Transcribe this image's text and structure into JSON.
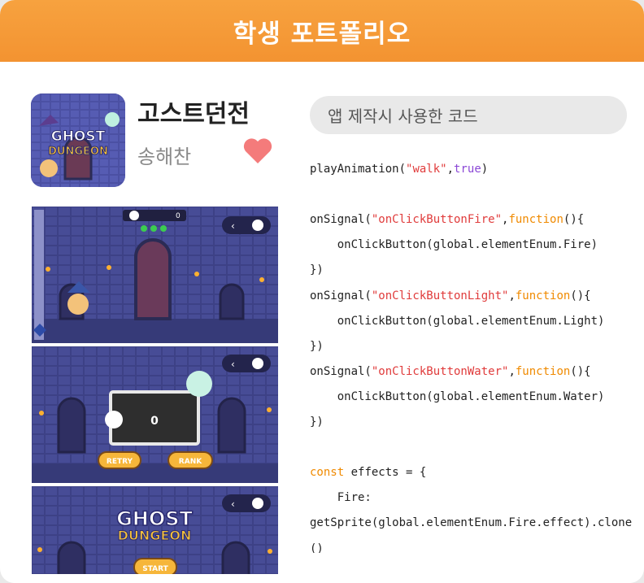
{
  "header": {
    "title": "학생 포트폴리오"
  },
  "app": {
    "title": "고스트던전",
    "author": "송해찬",
    "icon_text_1": "GHOST",
    "icon_text_2": "DUNGEON"
  },
  "shots": [
    {
      "counter": "0"
    },
    {
      "score": "0",
      "retry": "RETRY",
      "rank": "RANK"
    },
    {
      "logo_1": "GHOST",
      "logo_2": "DUNGEON",
      "start": "START"
    }
  ],
  "code": {
    "title": "앱 제작시 사용한 코드",
    "lines": [
      [
        {
          "t": "playAnimation(",
          "c": ""
        },
        {
          "t": "\"walk\"",
          "c": "str"
        },
        {
          "t": ",",
          "c": ""
        },
        {
          "t": "true",
          "c": "kw"
        },
        {
          "t": ")",
          "c": ""
        }
      ],
      [],
      [
        {
          "t": "onSignal(",
          "c": ""
        },
        {
          "t": "\"onClickButtonFire\"",
          "c": "str"
        },
        {
          "t": ",",
          "c": ""
        },
        {
          "t": "function",
          "c": "fn"
        },
        {
          "t": "(){",
          "c": ""
        }
      ],
      [
        {
          "t": "    onClickButton(global.elementEnum.Fire)",
          "c": ""
        }
      ],
      [
        {
          "t": "})",
          "c": ""
        }
      ],
      [
        {
          "t": "onSignal(",
          "c": ""
        },
        {
          "t": "\"onClickButtonLight\"",
          "c": "str"
        },
        {
          "t": ",",
          "c": ""
        },
        {
          "t": "function",
          "c": "fn"
        },
        {
          "t": "(){",
          "c": ""
        }
      ],
      [
        {
          "t": "    onClickButton(global.elementEnum.Light)",
          "c": ""
        }
      ],
      [
        {
          "t": "})",
          "c": ""
        }
      ],
      [
        {
          "t": "onSignal(",
          "c": ""
        },
        {
          "t": "\"onClickButtonWater\"",
          "c": "str"
        },
        {
          "t": ",",
          "c": ""
        },
        {
          "t": "function",
          "c": "fn"
        },
        {
          "t": "(){",
          "c": ""
        }
      ],
      [
        {
          "t": "    onClickButton(global.elementEnum.Water)",
          "c": ""
        }
      ],
      [
        {
          "t": "})",
          "c": ""
        }
      ],
      [],
      [
        {
          "t": "const",
          "c": "fn"
        },
        {
          "t": " effects = {",
          "c": ""
        }
      ],
      [
        {
          "t": "    Fire:",
          "c": ""
        }
      ],
      [
        {
          "t": "getSprite(global.elementEnum.Fire.effect).clone",
          "c": ""
        }
      ],
      [
        {
          "t": "()",
          "c": ""
        }
      ]
    ]
  },
  "colors": {
    "header": "#f39331",
    "heart": "#f47b7b",
    "string": "#e03b3b",
    "keyword": "#8b48d6",
    "function": "#f08a00"
  }
}
